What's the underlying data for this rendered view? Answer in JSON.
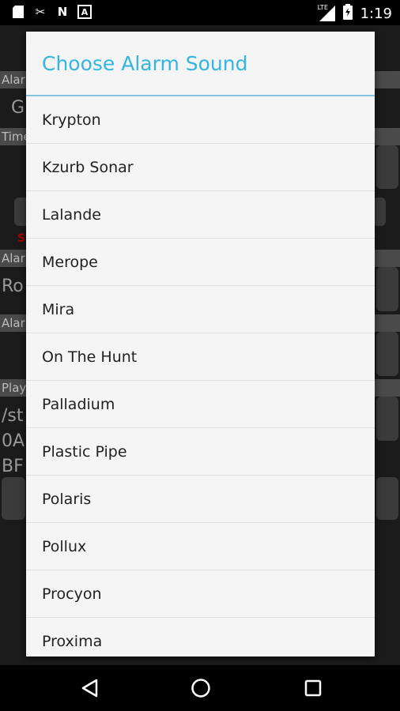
{
  "status_bar": {
    "time": "1:19",
    "icons_left": [
      "sd-card-icon",
      "missed-call-icon",
      "no-sim-icon",
      "a-box-icon"
    ],
    "icons_right": [
      "signal-lte-icon",
      "battery-icon"
    ],
    "lte_label": "LTE",
    "icon_glyphs": {
      "missed": "✂",
      "n": "N",
      "a": "A"
    }
  },
  "background": {
    "strips": [
      "Alar",
      "Time",
      "Alar",
      "Alar",
      "Play"
    ],
    "texts": [
      "G",
      "Ro",
      "/st",
      "0A",
      "BF"
    ]
  },
  "dialog": {
    "title": "Choose Alarm Sound",
    "items": [
      "Krypton",
      "Kzurb Sonar",
      "Lalande",
      "Merope",
      "Mira",
      "On The Hunt",
      "Palladium",
      "Plastic Pipe",
      "Polaris",
      "Pollux",
      "Procyon",
      "Proxima"
    ]
  },
  "nav": [
    "back-icon",
    "home-icon",
    "recents-icon"
  ]
}
